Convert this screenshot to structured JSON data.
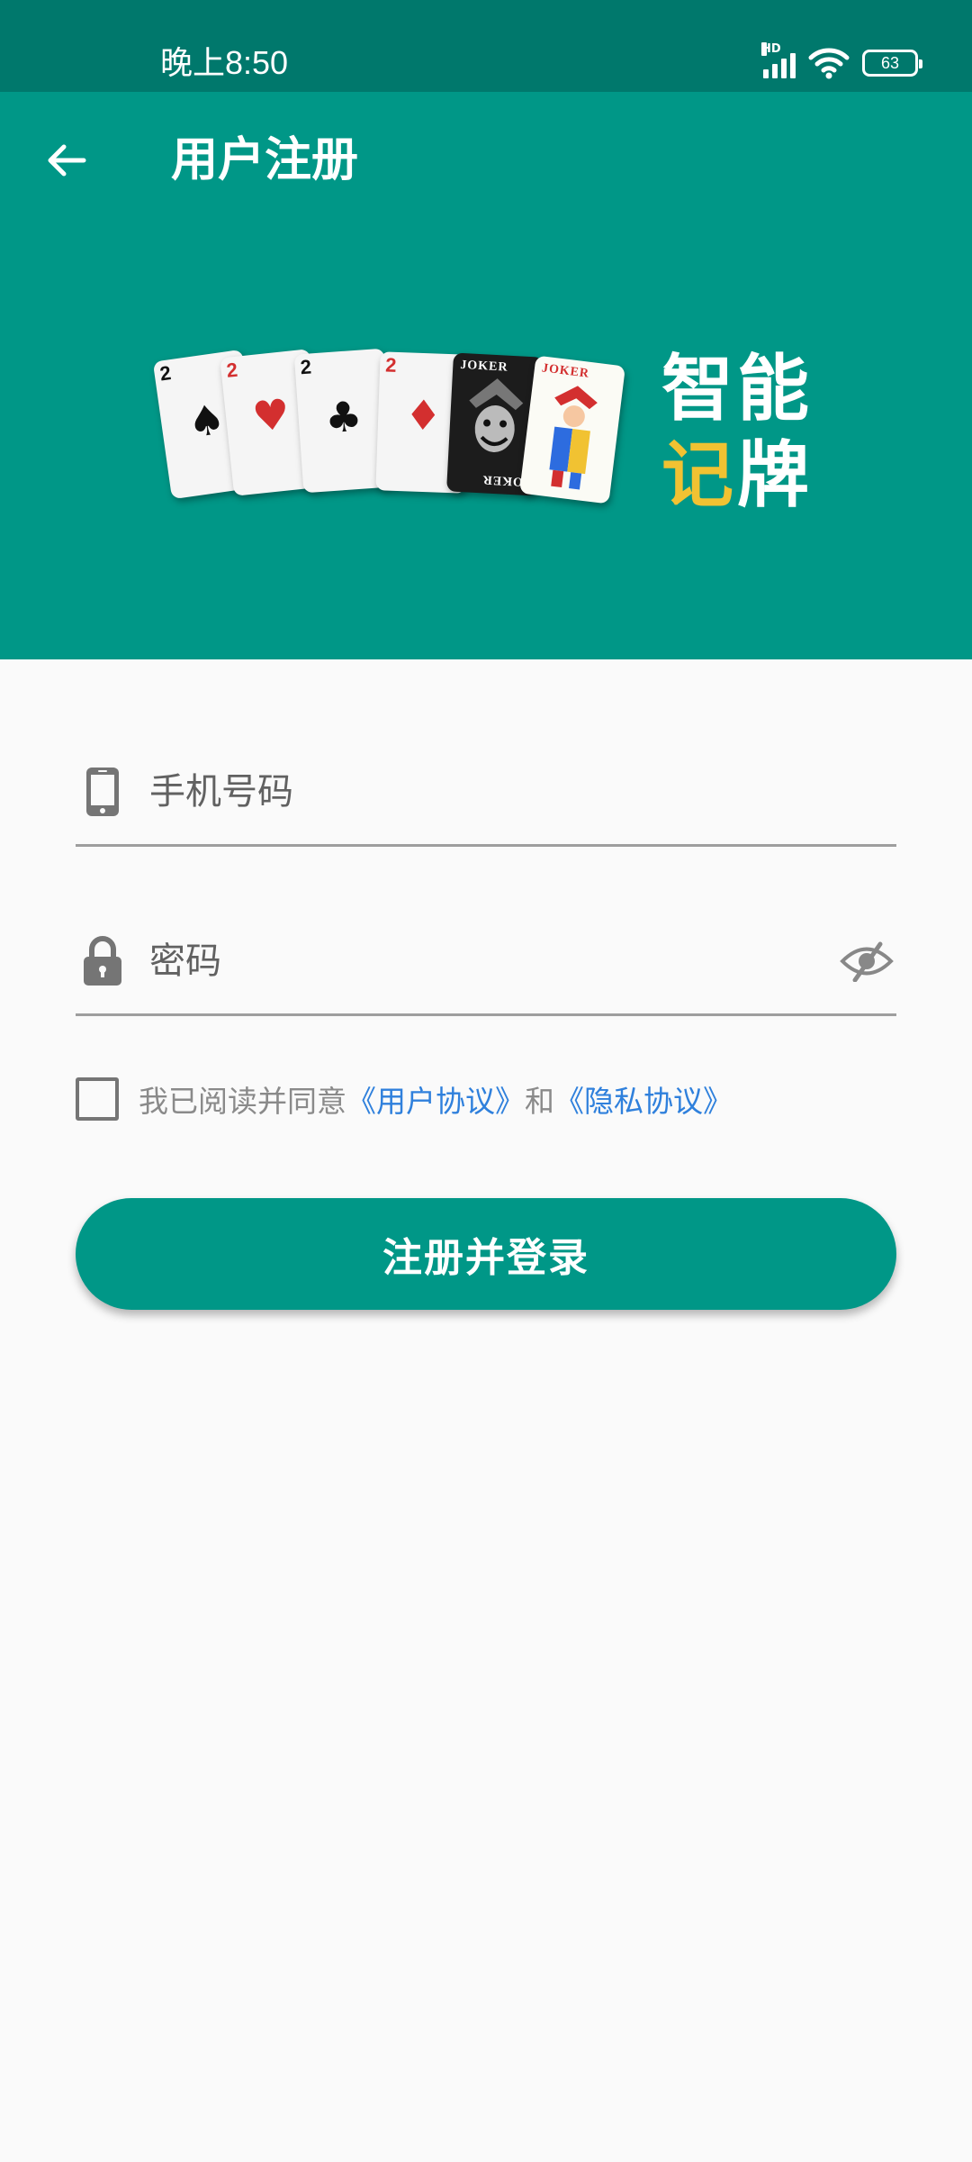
{
  "status_bar": {
    "time": "晚上8:50",
    "network_label": "HD",
    "battery": "63",
    "icons": [
      "signal-icon",
      "wifi-icon",
      "battery-icon"
    ]
  },
  "header": {
    "title": "用户注册",
    "back_icon": "arrow-left-icon"
  },
  "banner": {
    "brand_line_1": "智能",
    "brand_line_2a": "记",
    "brand_line_2b": "牌",
    "cards": [
      {
        "rank": "2",
        "suit": "♠",
        "color": "#111111"
      },
      {
        "rank": "2",
        "suit": "♥",
        "color": "#d32f2f"
      },
      {
        "rank": "2",
        "suit": "♣",
        "color": "#111111"
      },
      {
        "rank": "2",
        "suit": "♦",
        "color": "#d32f2f"
      }
    ],
    "joker_label": "JOKER",
    "joker_label_2": "JOKER",
    "joker_inverted": "JOKER"
  },
  "form": {
    "phone_placeholder": "手机号码",
    "password_placeholder": "密码",
    "agreement_prefix": "我已阅读并同意",
    "user_agreement": "《用户协议》",
    "conjunction": "和",
    "privacy_agreement": "《隐私协议》",
    "submit_label": "注册并登录"
  },
  "colors": {
    "primary": "#009787",
    "status_bar": "#00786c",
    "link": "#2f80dc",
    "background": "#fafafa"
  }
}
